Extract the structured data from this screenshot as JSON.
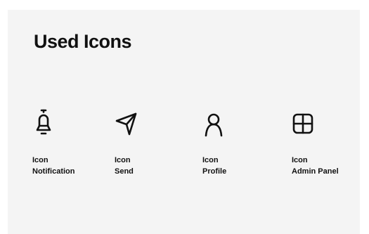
{
  "header": {
    "title": "Used Icons"
  },
  "icons": [
    {
      "caption_line1": "Icon",
      "caption_line2": "Notification",
      "icon_name": "bell-icon"
    },
    {
      "caption_line1": "Icon",
      "caption_line2": "Send",
      "icon_name": "send-icon"
    },
    {
      "caption_line1": "Icon",
      "caption_line2": "Profile",
      "icon_name": "profile-icon"
    },
    {
      "caption_line1": "Icon",
      "caption_line2": "Admin Panel",
      "icon_name": "admin-panel-icon"
    }
  ],
  "colors": {
    "background": "#ffffff",
    "panel": "#f4f4f4",
    "text": "#111111",
    "icon_stroke": "#111111"
  }
}
